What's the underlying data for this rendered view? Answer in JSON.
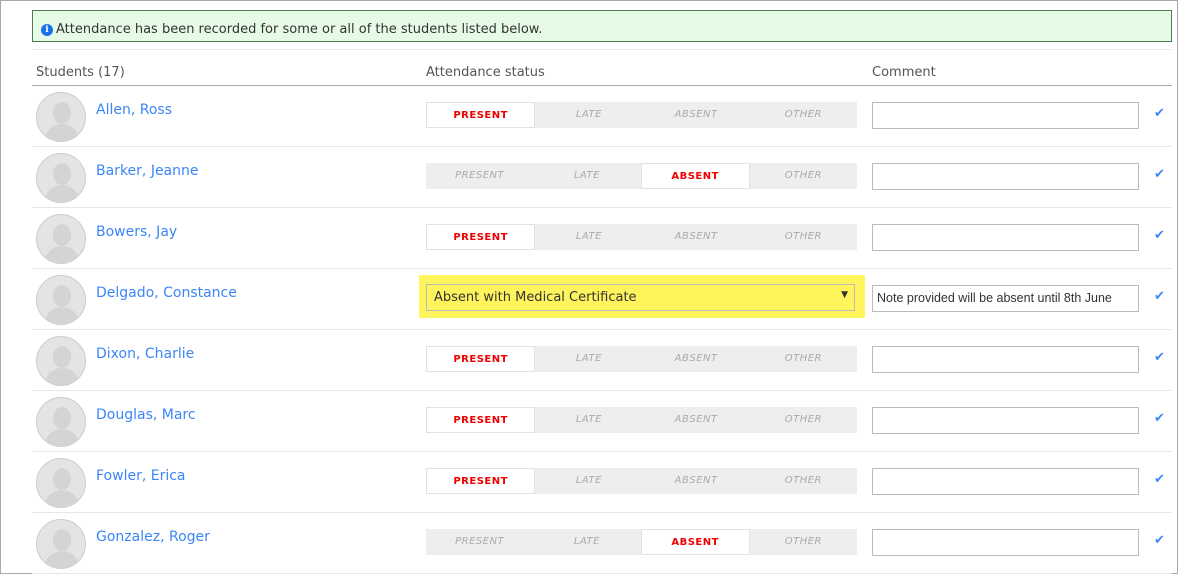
{
  "notice": {
    "text": "Attendance has been recorded for some or all of the students listed below.",
    "icon": "info-icon"
  },
  "headers": {
    "students": "Students (17)",
    "status": "Attendance status",
    "comment": "Comment"
  },
  "options": [
    "PRESENT",
    "LATE",
    "ABSENT",
    "OTHER"
  ],
  "accent": "#3b86f7",
  "selected_color": "#ee0000",
  "highlight": "#fff45b",
  "students": [
    {
      "name": "Allen, Ross",
      "status": "PRESENT",
      "comment": ""
    },
    {
      "name": "Barker, Jeanne",
      "status": "ABSENT",
      "comment": ""
    },
    {
      "name": "Bowers, Jay",
      "status": "PRESENT",
      "comment": ""
    },
    {
      "name": "Delgado, Constance",
      "status": "OTHER",
      "dropdown": "Absent with Medical Certificate",
      "comment": "Note provided will be absent until 8th June"
    },
    {
      "name": "Dixon, Charlie",
      "status": "PRESENT",
      "comment": ""
    },
    {
      "name": "Douglas, Marc",
      "status": "PRESENT",
      "comment": ""
    },
    {
      "name": "Fowler, Erica",
      "status": "PRESENT",
      "comment": ""
    },
    {
      "name": "Gonzalez, Roger",
      "status": "ABSENT",
      "comment": ""
    }
  ]
}
